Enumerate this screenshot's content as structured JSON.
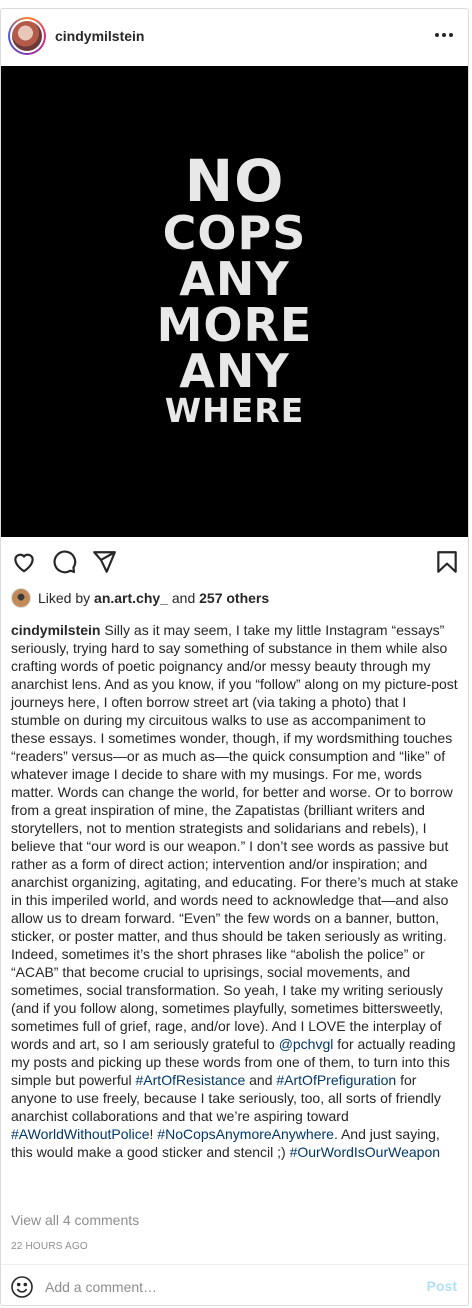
{
  "post": {
    "author": "cindymilstein",
    "image_text": [
      "NO",
      "COPS",
      "ANY",
      "MORE",
      "ANY",
      "WHERE"
    ],
    "likes": {
      "prefix": "Liked by",
      "user": "an.art.chy_",
      "middle": "and",
      "others": "257 others"
    },
    "caption": {
      "username": "cindymilstein",
      "body_1": " Silly as it may seem, I take my little Instagram “essays” seriously, trying hard to say something of substance in them while also crafting words of poetic poignancy and/or messy beauty through my anarchist lens. And as you know, if you “follow” along on my picture-post journeys here, I often borrow street art (via taking a photo) that I stumble on during my circuitous walks to use as accompaniment to these essays. I sometimes wonder, though, if my wordsmithing touches “readers” versus—or as much as—the quick consumption and “like” of whatever image I decide to share with my musings. For me, words matter. Words can change the world, for better and worse. Or to borrow from a great inspiration of mine, the Zapatistas (brilliant writers and storytellers, not to mention strategists and solidarians and rebels), I believe that “our word is our weapon.” I don’t see words as passive but rather as a form of direct action; intervention and/or inspiration; and anarchist organizing, agitating, and educating. For there’s much at stake in this imperiled world, and words need to acknowledge that—and also allow us to dream forward. “Even” the few words on a banner, button, sticker, or poster matter, and thus should be taken seriously as writing. Indeed, sometimes it’s the short phrases like “abolish the police” or “ACAB” that become crucial to uprisings, social movements, and sometimes, social transformation. So yeah, I take my writing seriously (and if you follow along, sometimes playfully, sometimes bittersweetly, sometimes full of grief, rage, and/or love). And I LOVE the interplay of words and art, so I am seriously grateful to ",
      "mention": "@pchvgl",
      "body_2": " for actually reading my posts and picking up these words from one of them, to turn into this simple but powerful ",
      "tag_1": "#ArtOfResistance",
      "body_3": " and ",
      "tag_2": "#ArtOfPrefiguration",
      "body_4": " for anyone to use freely, because I take seriously, too, all sorts of friendly anarchist collaborations and that we’re aspiring toward ",
      "tag_3": "#AWorldWithoutPolice",
      "body_5": "! ",
      "tag_4": "#NoCopsAnymoreAnywhere",
      "body_6": ". And just saying, this would make a good sticker and stencil ;) ",
      "tag_5": "#OurWordIsOurWeapon"
    },
    "view_comments": "View all 4 comments",
    "timestamp": "22 HOURS AGO"
  },
  "comment": {
    "placeholder": "Add a comment…",
    "post_label": "Post"
  },
  "icons": {
    "more": "more-options-icon",
    "like": "heart-icon",
    "comment": "comment-icon",
    "share": "share-icon",
    "save": "bookmark-icon",
    "emoji": "emoji-icon"
  },
  "colors": {
    "link": "#00376b",
    "muted": "#8e8e8e",
    "post_disabled": "#b2dffc"
  }
}
